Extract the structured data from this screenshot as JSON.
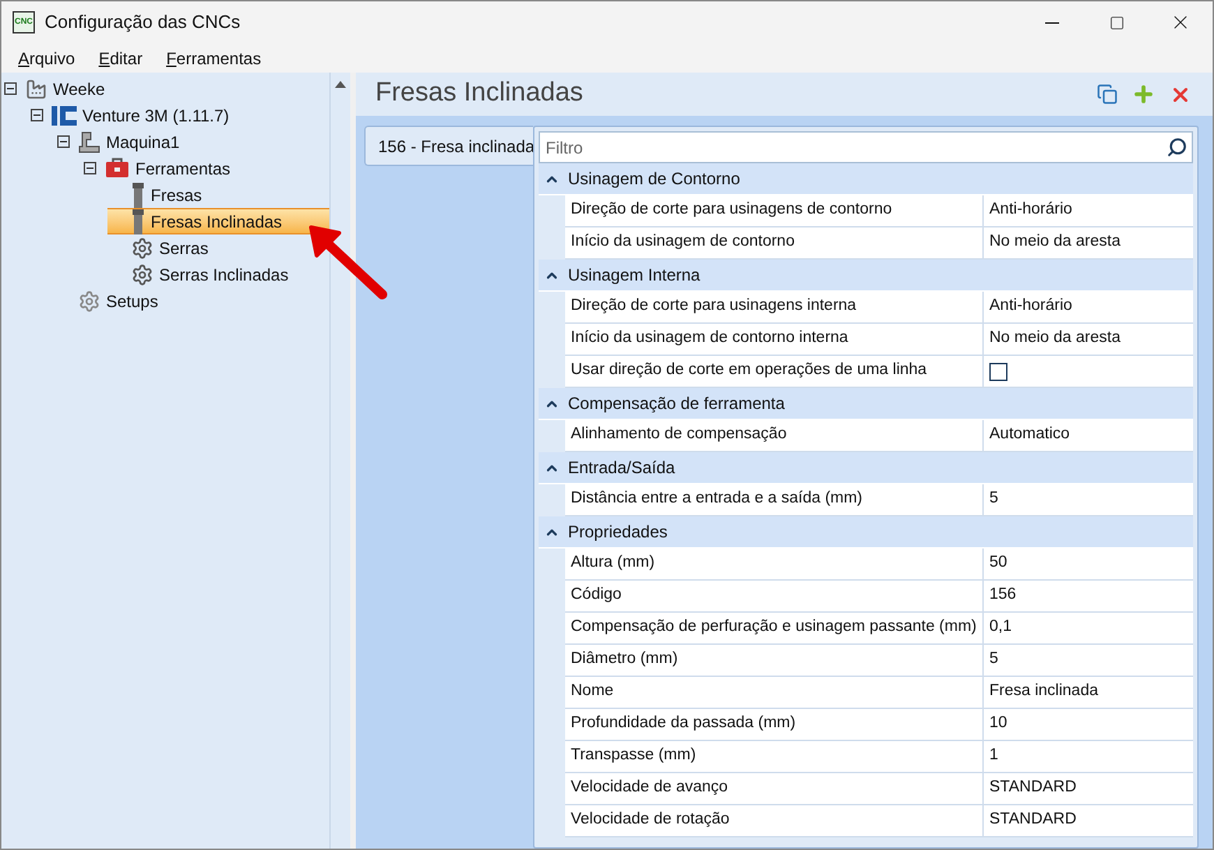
{
  "window": {
    "app_icon": "CNC",
    "title": "Configuração das CNCs"
  },
  "menu": [
    {
      "label": "Arquivo"
    },
    {
      "label": "Editar"
    },
    {
      "label": "Ferramentas"
    }
  ],
  "tree": [
    {
      "label": "Weeke",
      "kind": "factory",
      "expanded": true,
      "selected": false,
      "children": [
        {
          "label": "Venture 3M (1.11.7)",
          "kind": "brand",
          "expanded": true,
          "selected": false,
          "children": [
            {
              "label": "Maquina1",
              "kind": "machine",
              "expanded": true,
              "selected": false,
              "children": [
                {
                  "label": "Ferramentas",
                  "kind": "toolbox",
                  "expanded": true,
                  "selected": false,
                  "children": [
                    {
                      "label": "Fresas",
                      "kind": "cutter",
                      "selected": false
                    },
                    {
                      "label": "Fresas Inclinadas",
                      "kind": "cutter",
                      "selected": true
                    },
                    {
                      "label": "Serras",
                      "kind": "saw",
                      "selected": false
                    },
                    {
                      "label": "Serras Inclinadas",
                      "kind": "saw",
                      "selected": false
                    }
                  ]
                }
              ]
            },
            {
              "label": "Setups",
              "kind": "setup",
              "selected": false
            }
          ]
        }
      ]
    }
  ],
  "panel": {
    "title": "Fresas Inclinadas",
    "tabs": [
      {
        "label": "156 - Fresa inclinada",
        "selected": true
      }
    ],
    "filter": {
      "placeholder": "Filtro"
    },
    "categories": [
      {
        "label": "Usinagem de Contorno",
        "expanded": true,
        "rows": [
          {
            "kind": "text",
            "label": "Direção de corte para usinagens de contorno",
            "value": "Anti-horário"
          },
          {
            "kind": "text",
            "label": "Início da usinagem de contorno",
            "value": "No meio da aresta"
          }
        ]
      },
      {
        "label": "Usinagem Interna",
        "expanded": true,
        "rows": [
          {
            "kind": "text",
            "label": "Direção de corte para usinagens interna",
            "value": "Anti-horário"
          },
          {
            "kind": "text",
            "label": "Início da usinagem de contorno interna",
            "value": "No meio da aresta"
          },
          {
            "kind": "checkbox",
            "label": "Usar direção de corte em operações de uma linha",
            "checked": false
          }
        ]
      },
      {
        "label": "Compensação de ferramenta",
        "expanded": true,
        "rows": [
          {
            "kind": "text",
            "label": "Alinhamento de compensação",
            "value": "Automatico"
          }
        ]
      },
      {
        "label": "Entrada/Saída",
        "expanded": true,
        "rows": [
          {
            "kind": "text",
            "label": "Distância entre a entrada e a saída (mm)",
            "value": "5"
          }
        ]
      },
      {
        "label": "Propriedades",
        "expanded": true,
        "rows": [
          {
            "kind": "text",
            "label": "Altura (mm)",
            "value": "50"
          },
          {
            "kind": "text",
            "label": "Código",
            "value": "156"
          },
          {
            "kind": "text",
            "label": "Compensação de perfuração e usinagem passante (mm)",
            "value": "0,1"
          },
          {
            "kind": "text",
            "label": "Diâmetro (mm)",
            "value": "5"
          },
          {
            "kind": "text",
            "label": "Nome",
            "value": "Fresa inclinada"
          },
          {
            "kind": "text",
            "label": "Profundidade da passada (mm)",
            "value": "10"
          },
          {
            "kind": "text",
            "label": "Transpasse (mm)",
            "value": "1"
          },
          {
            "kind": "text",
            "label": "Velocidade de avanço",
            "value": "STANDARD"
          },
          {
            "kind": "text",
            "label": "Velocidade de rotação",
            "value": "STANDARD"
          }
        ]
      }
    ]
  }
}
